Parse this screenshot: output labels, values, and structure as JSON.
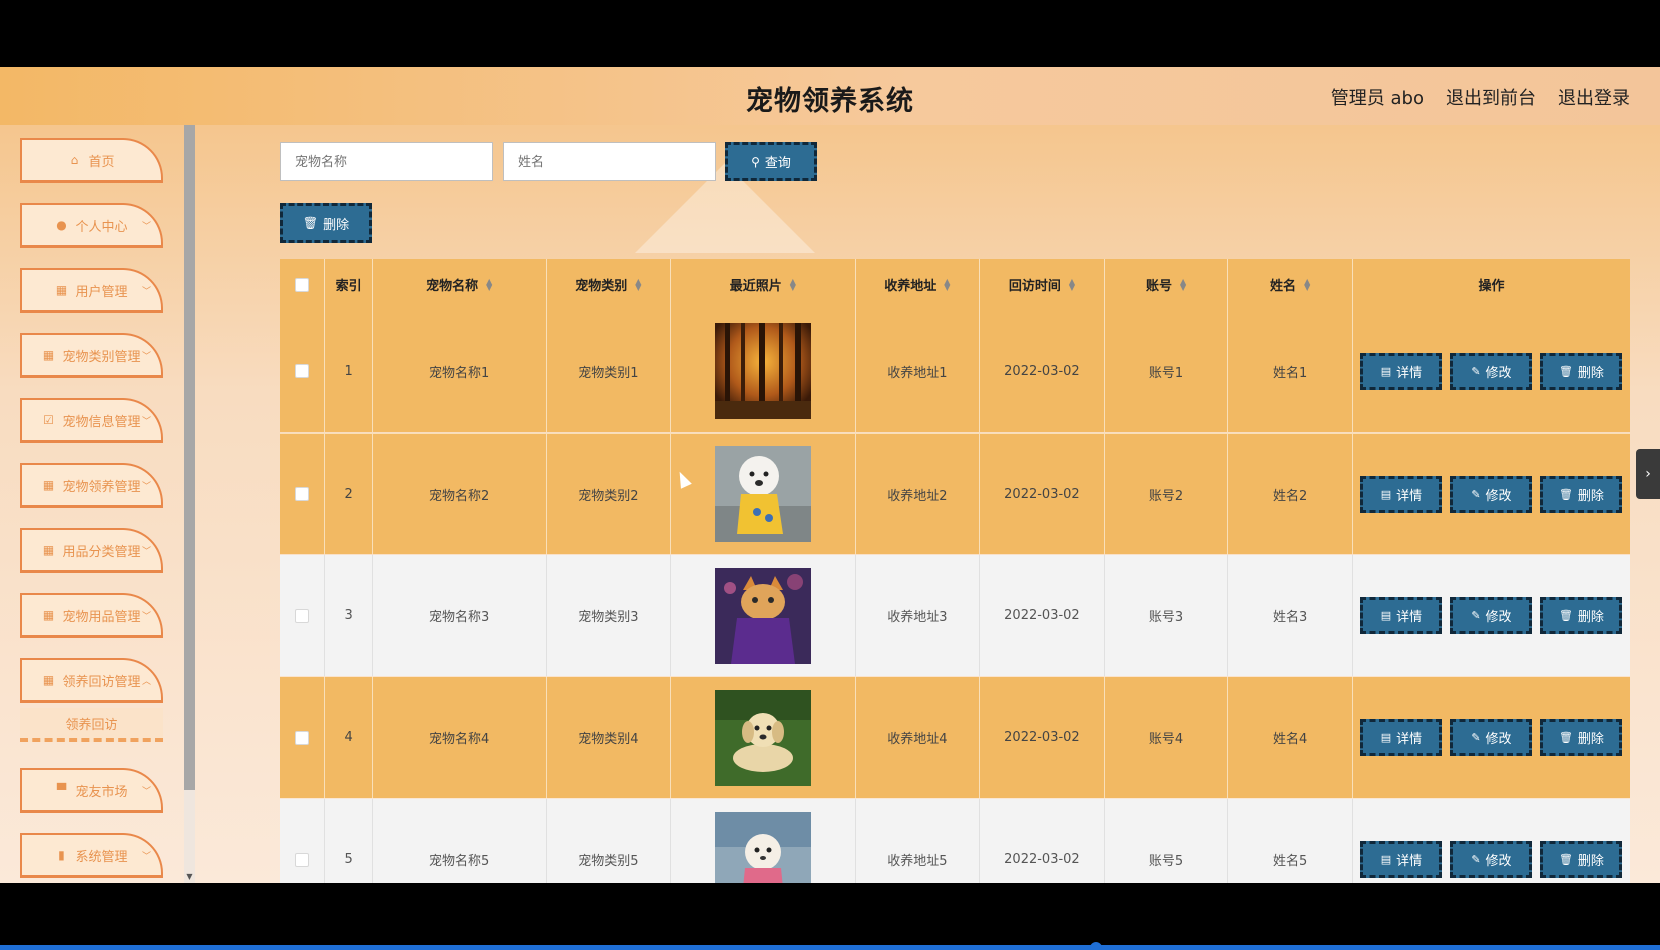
{
  "header": {
    "title": "宠物领养系统",
    "admin_label": "管理员 abo",
    "back_front": "退出到前台",
    "logout": "退出登录"
  },
  "sidebar": {
    "items": [
      {
        "label": "首页",
        "icon": "home-icon"
      },
      {
        "label": "个人中心",
        "icon": "user-icon"
      },
      {
        "label": "用户管理",
        "icon": "grid-icon"
      },
      {
        "label": "宠物类别管理",
        "icon": "grid-icon"
      },
      {
        "label": "宠物信息管理",
        "icon": "check-square-icon"
      },
      {
        "label": "宠物领养管理",
        "icon": "grid-icon"
      },
      {
        "label": "用品分类管理",
        "icon": "grid-icon"
      },
      {
        "label": "宠物用品管理",
        "icon": "grid-icon"
      },
      {
        "label": "领养回访管理",
        "icon": "grid-icon"
      },
      {
        "label": "宠友市场",
        "icon": "shop-icon"
      },
      {
        "label": "系统管理",
        "icon": "chart-icon"
      }
    ],
    "submenu": {
      "label": "领养回访"
    }
  },
  "search": {
    "pet_name_placeholder": "宠物名称",
    "name_placeholder": "姓名",
    "query_label": "查询",
    "delete_label": "删除"
  },
  "table": {
    "columns": [
      "索引",
      "宠物名称",
      "宠物类别",
      "最近照片",
      "收养地址",
      "回访时间",
      "账号",
      "姓名",
      "操作"
    ],
    "rows": [
      {
        "index": "1",
        "pet_name": "宠物名称1",
        "pet_type": "宠物类别1",
        "photo": "forest-photo",
        "address": "收养地址1",
        "visit_time": "2022-03-02",
        "account": "账号1",
        "name": "姓名1"
      },
      {
        "index": "2",
        "pet_name": "宠物名称2",
        "pet_type": "宠物类别2",
        "photo": "white-dog-photo",
        "address": "收养地址2",
        "visit_time": "2022-03-02",
        "account": "账号2",
        "name": "姓名2"
      },
      {
        "index": "3",
        "pet_name": "宠物名称3",
        "pet_type": "宠物类别3",
        "photo": "cat-photo",
        "address": "收养地址3",
        "visit_time": "2022-03-02",
        "account": "账号3",
        "name": "姓名3"
      },
      {
        "index": "4",
        "pet_name": "宠物名称4",
        "pet_type": "宠物类别4",
        "photo": "puppy-grass-photo",
        "address": "收养地址4",
        "visit_time": "2022-03-02",
        "account": "账号4",
        "name": "姓名4"
      },
      {
        "index": "5",
        "pet_name": "宠物名称5",
        "pet_type": "宠物类别5",
        "photo": "poodle-photo",
        "address": "收养地址5",
        "visit_time": "2022-03-02",
        "account": "账号5",
        "name": "姓名5"
      }
    ],
    "actions": {
      "detail": "详情",
      "edit": "修改",
      "delete": "删除"
    }
  },
  "colors": {
    "accent": "#2d6c93",
    "row_highlight": "#f2b963",
    "menu_text": "#e8934f"
  }
}
